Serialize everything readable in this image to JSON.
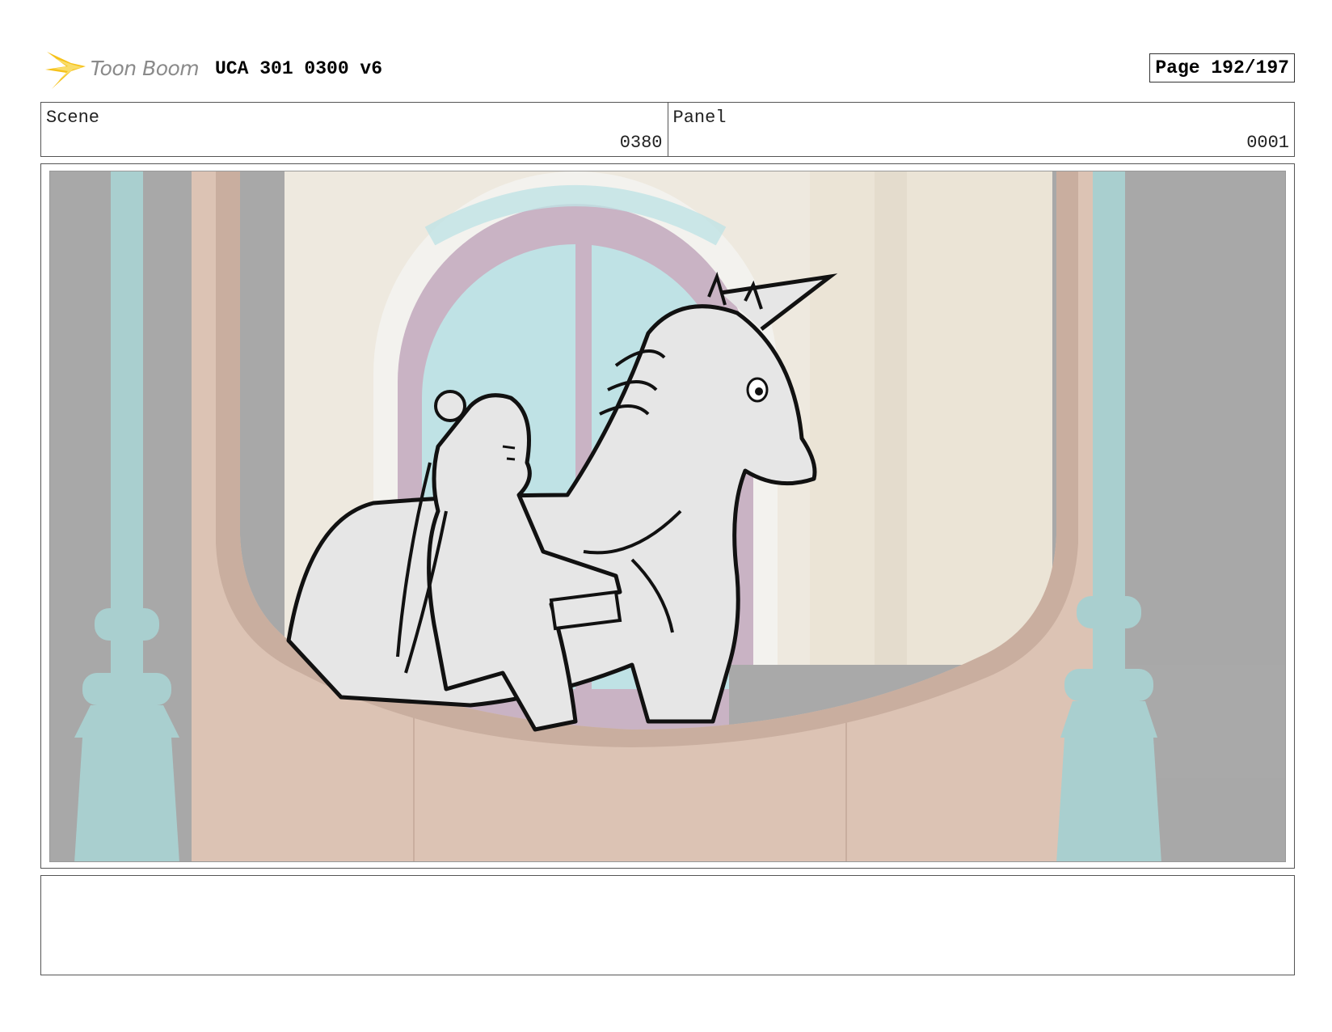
{
  "header": {
    "logo_text": "Toon Boom",
    "title": "UCA 301 0300 v6",
    "page": "Page 192/197"
  },
  "info": {
    "scene_label": "Scene",
    "scene_value": "0380",
    "panel_label": "Panel",
    "panel_value": "0001"
  },
  "notes": {
    "text": ""
  },
  "colors": {
    "wall": "#ece7dc",
    "arch_pink": "#c9b3c4",
    "window_blue": "#bfe2e5",
    "column_teal": "#a9cfcf",
    "balcony_tan": "#dcc3b4",
    "logo_yellow": "#f6c21b"
  }
}
